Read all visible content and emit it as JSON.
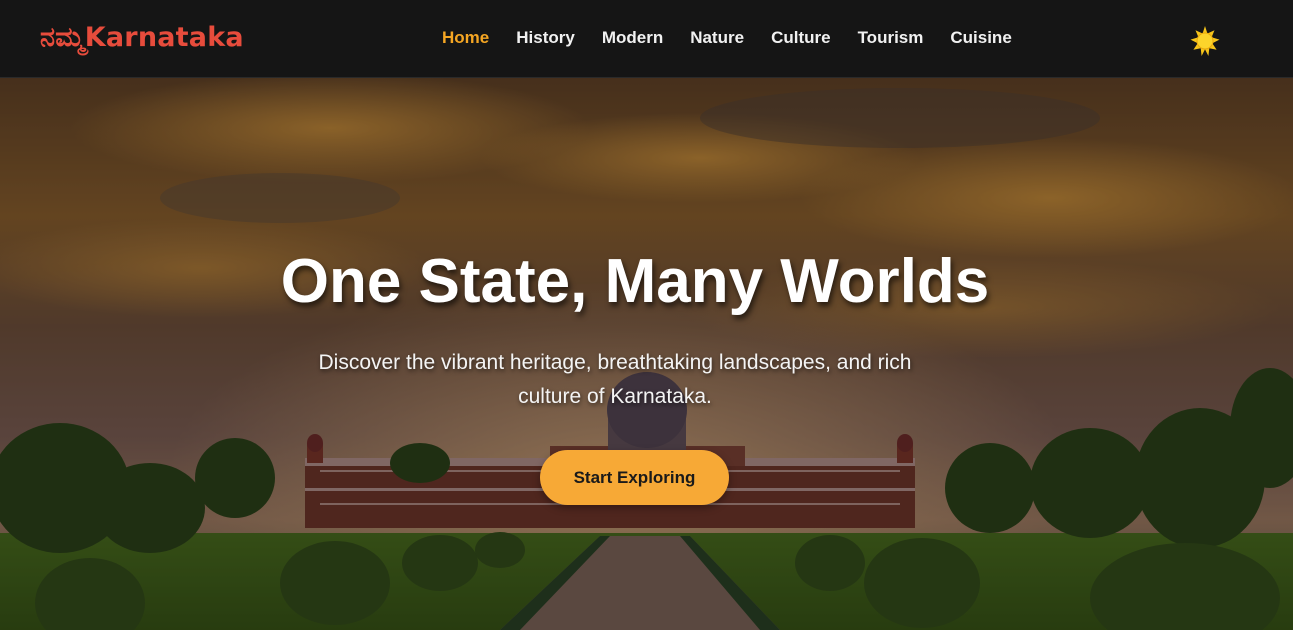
{
  "brand": {
    "logo_kannada": "ನಮ್ಮ",
    "logo_name": "Karnataka"
  },
  "nav": {
    "items": [
      {
        "label": "Home",
        "active": true
      },
      {
        "label": "History",
        "active": false
      },
      {
        "label": "Modern",
        "active": false
      },
      {
        "label": "Nature",
        "active": false
      },
      {
        "label": "Culture",
        "active": false
      },
      {
        "label": "Tourism",
        "active": false
      },
      {
        "label": "Cuisine",
        "active": false
      }
    ],
    "theme_toggle_icon": "sun-icon"
  },
  "hero": {
    "title": "One State, Many Worlds",
    "subtitle": "Discover the vibrant heritage, breathtaking landscapes, and rich culture of Karnataka.",
    "cta_label": "Start Exploring",
    "background_image": "palace-sunset-photo"
  },
  "colors": {
    "brand_red": "#e74c3c",
    "accent": "#f5a623",
    "button": "#f7a936",
    "navbar": "#151515"
  }
}
